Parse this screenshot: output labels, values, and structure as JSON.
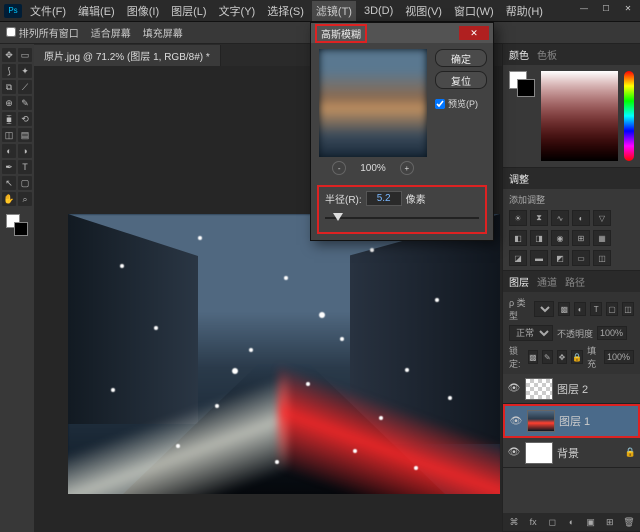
{
  "app": {
    "logo": "Ps"
  },
  "menu": [
    "文件(F)",
    "编辑(E)",
    "图像(I)",
    "图层(L)",
    "文字(Y)",
    "选择(S)",
    "滤镜(T)",
    "3D(D)",
    "视图(V)",
    "窗口(W)",
    "帮助(H)"
  ],
  "menu_active_index": 6,
  "optionbar": {
    "arrange": "排列所有窗口",
    "fit_view": "适合屏幕",
    "fill_screen": "填充屏幕"
  },
  "document": {
    "tab": "原片.jpg @ 71.2% (图层 1, RGB/8#) *"
  },
  "dialog": {
    "title": "高斯模糊",
    "ok": "确定",
    "cancel": "复位",
    "preview_chk": "预览(P)",
    "zoom": "100%",
    "radius_label": "半径(R):",
    "radius_value": "5.2",
    "radius_unit": "像素"
  },
  "panels": {
    "color": {
      "tabs": [
        "颜色",
        "色板"
      ]
    },
    "adjust": {
      "header": "调整",
      "sub": "添加调整"
    },
    "layers": {
      "tabs": [
        "图层",
        "通道",
        "路径"
      ],
      "kind_label": "ρ 类型",
      "blend_mode": "正常",
      "opacity_label": "不透明度",
      "opacity_value": "100%",
      "lock_label": "锁定:",
      "fill_label": "填充",
      "fill_value": "100%",
      "items": [
        {
          "name": "图层 2",
          "thumb": "checker"
        },
        {
          "name": "图层 1",
          "thumb": "photo",
          "selected": true
        },
        {
          "name": "背景",
          "thumb": "bg"
        }
      ]
    }
  }
}
